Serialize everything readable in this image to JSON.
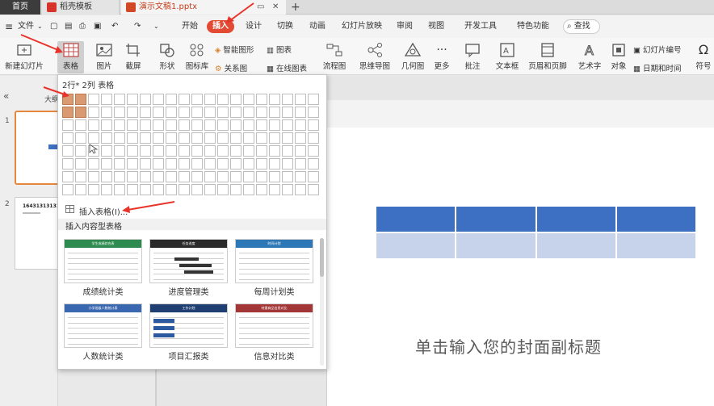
{
  "tabs": {
    "home": "首页",
    "templates": "稻壳模板",
    "document": "演示文稿1.pptx",
    "new_tab": "+"
  },
  "menu": {
    "file": "文件",
    "items": [
      "开始",
      "插入",
      "设计",
      "切换",
      "动画",
      "幻灯片放映",
      "审阅",
      "视图",
      "开发工具",
      "特色功能"
    ],
    "active": "插入",
    "search": "查找"
  },
  "ribbon": {
    "new_slide": "新建幻灯片",
    "table": "表格",
    "image": "图片",
    "screenshot": "截屏",
    "shape": "形状",
    "icon_lib": "图标库",
    "smart_graphic": "智能图形",
    "relation": "关系图",
    "chart": "图表",
    "online_chart": "在线图表",
    "flowchart": "流程图",
    "mindmap": "思维导图",
    "geometry": "几何图",
    "more": "更多",
    "comment": "批注",
    "textbox": "文本框",
    "header_footer": "页眉和页脚",
    "wordart": "艺术字",
    "object": "对象",
    "slide_number": "幻灯片编号",
    "datetime": "日期和时间",
    "symbol": "符号"
  },
  "left_panel": {
    "size_label": "大纲",
    "slide1_num": "1",
    "slide2_num": "2",
    "slide2_text": "16431313131"
  },
  "dropdown": {
    "title": "2行* 2列 表格",
    "grid_rows": 8,
    "grid_cols": 20,
    "selected_rows": 2,
    "selected_cols": 2,
    "insert_table": "插入表格(I)...",
    "section": "插入内容型表格",
    "templates": [
      {
        "caption": "成绩统计类",
        "color": "#2e8b4f",
        "header": "学生成绩综合表"
      },
      {
        "caption": "进度管理类",
        "color": "#2a2a2a",
        "header": "任务进度"
      },
      {
        "caption": "每周计划类",
        "color": "#2c77b5",
        "header": "时间计划"
      },
      {
        "caption": "人数统计类",
        "color": "#3a68b0",
        "header": "小学班级人数统计表"
      },
      {
        "caption": "项目汇报类",
        "color": "#1f3f73",
        "header": "工作计划"
      },
      {
        "caption": "信息对比类",
        "color": "#a33636",
        "header": "特惠商品信息对比"
      }
    ]
  },
  "slide": {
    "subtitle": "单击输入您的封面副标题",
    "table_header_color": "#3d6fc2",
    "table_row_color": "#c6d3ea",
    "cols": 4
  },
  "annotation_color": "#e8332a"
}
